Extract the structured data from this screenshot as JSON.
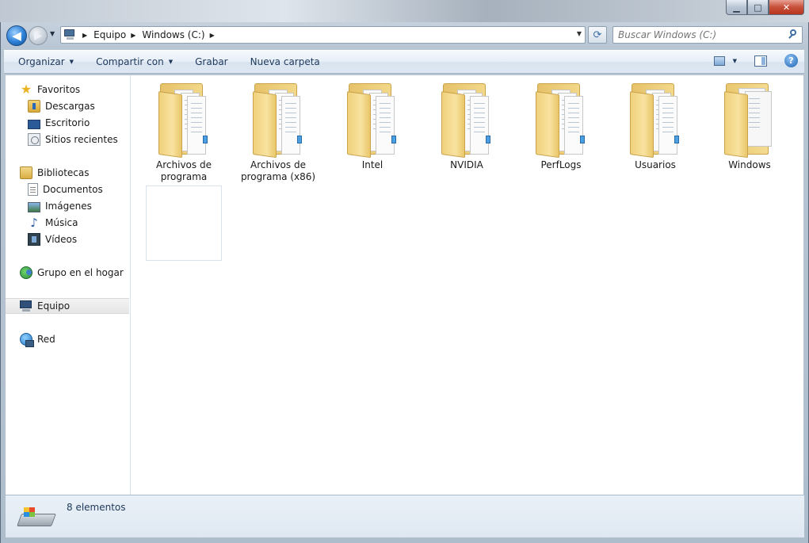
{
  "address": {
    "crumbs": [
      "Equipo",
      "Windows (C:)"
    ]
  },
  "search": {
    "placeholder": "Buscar Windows (C:)"
  },
  "toolbar": {
    "organize": "Organizar",
    "share": "Compartir con",
    "burn": "Grabar",
    "new_folder": "Nueva carpeta"
  },
  "nav": {
    "favorites": "Favoritos",
    "downloads": "Descargas",
    "desktop": "Escritorio",
    "recent": "Sitios recientes",
    "libraries": "Bibliotecas",
    "documents": "Documentos",
    "images": "Imágenes",
    "music": "Música",
    "videos": "Vídeos",
    "homegroup": "Grupo en el hogar",
    "computer": "Equipo",
    "network": "Red"
  },
  "folders": [
    {
      "name": "Archivos de programa"
    },
    {
      "name": "Archivos de programa (x86)"
    },
    {
      "name": "Intel"
    },
    {
      "name": "NVIDIA"
    },
    {
      "name": "PerfLogs"
    },
    {
      "name": "Usuarios"
    },
    {
      "name": "Windows"
    }
  ],
  "status": {
    "count": "8 elementos"
  },
  "icons": {
    "back": "back-arrow-icon",
    "forward": "forward-arrow-icon",
    "refresh": "refresh-icon",
    "search": "search-icon",
    "view": "change-view-icon",
    "preview_pane": "preview-pane-icon",
    "help": "help-icon"
  },
  "colors": {
    "accent": "#2c7fd6",
    "command_text": "#1e395b",
    "selection": "#e6e6e6"
  }
}
